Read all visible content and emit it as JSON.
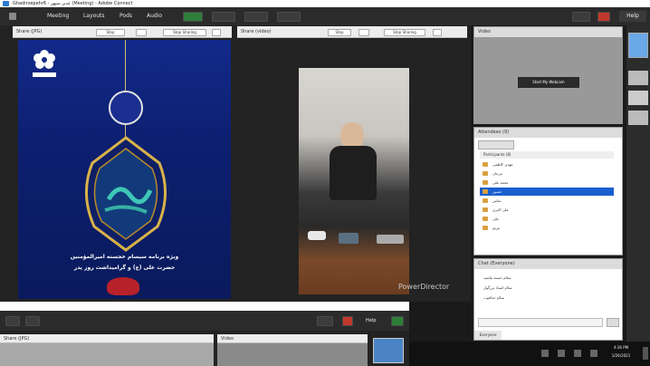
{
  "titlebar": {
    "title": "Ghadirsepehr6 - غدیر سپهر (Meeting) - Adobe Connect"
  },
  "menubar": {
    "items": [
      "Meeting",
      "Layouts",
      "Pods",
      "Audio"
    ],
    "help": "Help"
  },
  "share_pod": {
    "title": "Share (JPG)",
    "buttons": [
      "Stop",
      "Stop Sharing"
    ]
  },
  "video_share_pod": {
    "title": "Share (video)",
    "buttons": [
      "Stop",
      "Stop Sharing"
    ]
  },
  "banner": {
    "caption_line1": "ویژه برنامه سیسام خجسته امیرالمؤمنین",
    "caption_line2": "حضرت علی (ع) و گرامیداشت روز پدر"
  },
  "watermark": "PowerDirector",
  "video_pod": {
    "title": "Video",
    "start_button": "Start My Webcam"
  },
  "attendees_pod": {
    "title": "Attendees (9)",
    "group_label": "Participants (8)",
    "rows": [
      "مهدی کاظمی",
      "مرجان",
      "محمد علی",
      "حسین",
      "عباس",
      "علی اکبری",
      "علی",
      "مریم"
    ],
    "selected_index": 3
  },
  "chat_pod": {
    "title": "Chat (Everyone)",
    "lines": [
      "سلام خسته نباشید",
      "سلام استاد بزرگوار",
      "سلام خداقوت"
    ],
    "input_placeholder": "",
    "tab": "Everyone"
  },
  "bottom_window": {
    "help": "Help",
    "share_title": "Share (JPG)",
    "video_title": "Video"
  },
  "taskbar": {
    "time": "4:36 PM",
    "date": "1/26/2021"
  }
}
